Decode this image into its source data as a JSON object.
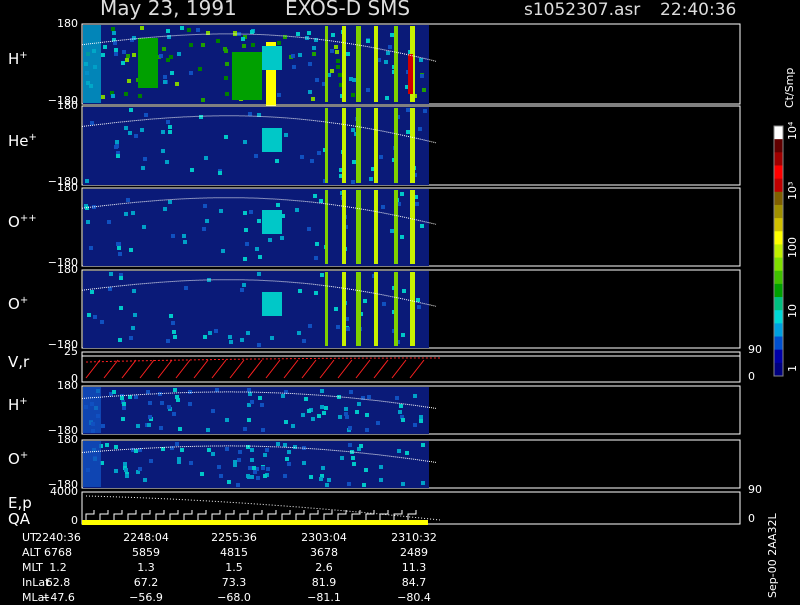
{
  "header": {
    "date": "May 23, 1991",
    "instrument": "EXOS-D SMS",
    "file": "s1052307.asr",
    "time": "22:40:36"
  },
  "panels": [
    {
      "label": "H",
      "charge": "+",
      "ytop": "180",
      "ybot": "−180"
    },
    {
      "label": "He",
      "charge": "+",
      "ytop": "180",
      "ybot": "−180"
    },
    {
      "label": "O",
      "charge": "++",
      "ytop": "180",
      "ybot": "−180"
    },
    {
      "label": "O",
      "charge": "+",
      "ytop": "180",
      "ybot": "−180"
    },
    {
      "label": "V,r",
      "charge": "",
      "ytop": "25",
      "ybot": "0",
      "rtop": "90",
      "rbot": "0"
    },
    {
      "label": "H",
      "charge": "+",
      "ytop": "180",
      "ybot": "−180"
    },
    {
      "label": "O",
      "charge": "+",
      "ytop": "180",
      "ybot": "−180"
    },
    {
      "label": "E,p",
      "label2": "QA",
      "charge": "",
      "ytop": "4000",
      "ybot": "0",
      "rtop": "90",
      "rbot": "0"
    }
  ],
  "colorbar": {
    "unit": "Ct/Smp",
    "ticks": [
      "1",
      "10",
      "100",
      "10³",
      "10⁴"
    ],
    "colors": [
      "#000080",
      "#0000a8",
      "#0050d0",
      "#00a0e0",
      "#00d8d8",
      "#00c080",
      "#00a000",
      "#40c000",
      "#80e000",
      "#c0f000",
      "#ffff00",
      "#d0c000",
      "#a09000",
      "#806000",
      "#c00000",
      "#ff0000",
      "#a00000",
      "#600000",
      "#ffffff"
    ]
  },
  "ut_table": {
    "row_labels": [
      "UT",
      "ALT",
      "MLT",
      "InLat",
      "MLat"
    ],
    "columns": [
      [
        "2240:36",
        "6768",
        "1.2",
        "62.8",
        "−47.6"
      ],
      [
        "2248:04",
        "5859",
        "1.3",
        "67.2",
        "−56.9"
      ],
      [
        "2255:36",
        "4815",
        "1.5",
        "73.3",
        "−68.0"
      ],
      [
        "2303:04",
        "3678",
        "2.6",
        "81.9",
        "−81.1"
      ],
      [
        "2310:32",
        "2489",
        "11.3",
        "84.7",
        "−80.4"
      ]
    ]
  },
  "footer_label": "Sep-00  2AA32L",
  "chart_data": {
    "type": "heatmap",
    "x": [
      "2240:36",
      "2248:04",
      "2255:36",
      "2303:04",
      "2310:32"
    ],
    "ylim": [
      -180,
      180
    ],
    "series": [
      {
        "name": "H+",
        "ylim": [
          -180,
          180
        ]
      },
      {
        "name": "He+",
        "ylim": [
          -180,
          180
        ]
      },
      {
        "name": "O++",
        "ylim": [
          -180,
          180
        ]
      },
      {
        "name": "O+",
        "ylim": [
          -180,
          180
        ]
      },
      {
        "name": "V,r",
        "ylim": [
          0,
          25
        ],
        "right_ylim": [
          0,
          90
        ]
      },
      {
        "name": "H+",
        "ylim": [
          -180,
          180
        ]
      },
      {
        "name": "O+",
        "ylim": [
          -180,
          180
        ]
      },
      {
        "name": "E,p",
        "ylim": [
          0,
          4000
        ],
        "right_ylim": [
          0,
          90
        ]
      }
    ],
    "colorbar_range": [
      1,
      10000
    ]
  }
}
